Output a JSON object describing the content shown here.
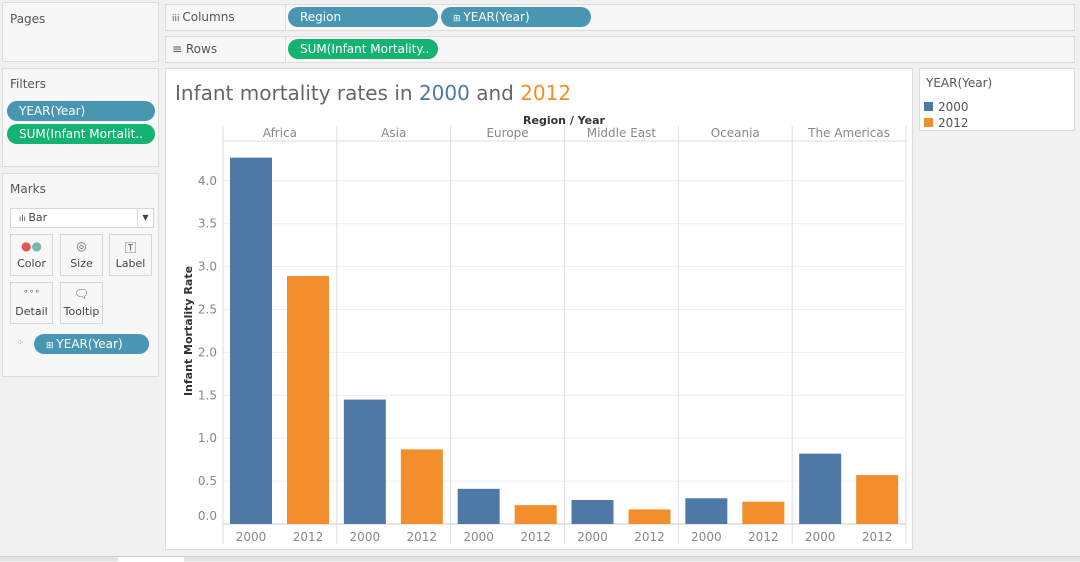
{
  "pages": {
    "label": "Pages"
  },
  "shelves": {
    "columns_label": "Columns",
    "columns_icon": "columns-icon",
    "columns": [
      "Region",
      "YEAR(Year)"
    ],
    "rows_label": "Rows",
    "rows_icon": "rows-icon",
    "rows": [
      "SUM(Infant Mortality.."
    ]
  },
  "filters": {
    "label": "Filters",
    "items": [
      "YEAR(Year)",
      "SUM(Infant Mortalit.."
    ]
  },
  "marks": {
    "label": "Marks",
    "type": "Bar",
    "buttons": [
      "Color",
      "Size",
      "Label",
      "Detail",
      "Tooltip"
    ],
    "color_pill": "YEAR(Year)"
  },
  "title": {
    "prefix": "Infant mortality rates in ",
    "y1": "2000",
    "mid": " and ",
    "y2": "2012"
  },
  "legend": {
    "title": "YEAR(Year)",
    "items": [
      {
        "label": "2000",
        "color": "#4e79a7"
      },
      {
        "label": "2012",
        "color": "#f28e2b"
      }
    ]
  },
  "chart_data": {
    "type": "bar",
    "title": "Infant mortality rates in 2000 and 2012",
    "header": "Region / Year",
    "xlabel": "",
    "ylabel": "Infant Mortality Rate",
    "ylim": [
      0,
      4.4
    ],
    "yticks": [
      "0.0",
      "0.5",
      "1.0",
      "1.5",
      "2.0",
      "2.5",
      "3.0",
      "3.5",
      "4.0"
    ],
    "categories": [
      "Africa",
      "Asia",
      "Europe",
      "Middle East",
      "Oceania",
      "The Americas"
    ],
    "series": [
      {
        "name": "2000",
        "color": "#4e79a7",
        "values": [
          4.27,
          1.45,
          0.41,
          0.28,
          0.3,
          0.82
        ]
      },
      {
        "name": "2012",
        "color": "#f28e2b",
        "values": [
          2.89,
          0.87,
          0.22,
          0.17,
          0.26,
          0.57
        ]
      }
    ],
    "legend": "right",
    "grid": true
  }
}
